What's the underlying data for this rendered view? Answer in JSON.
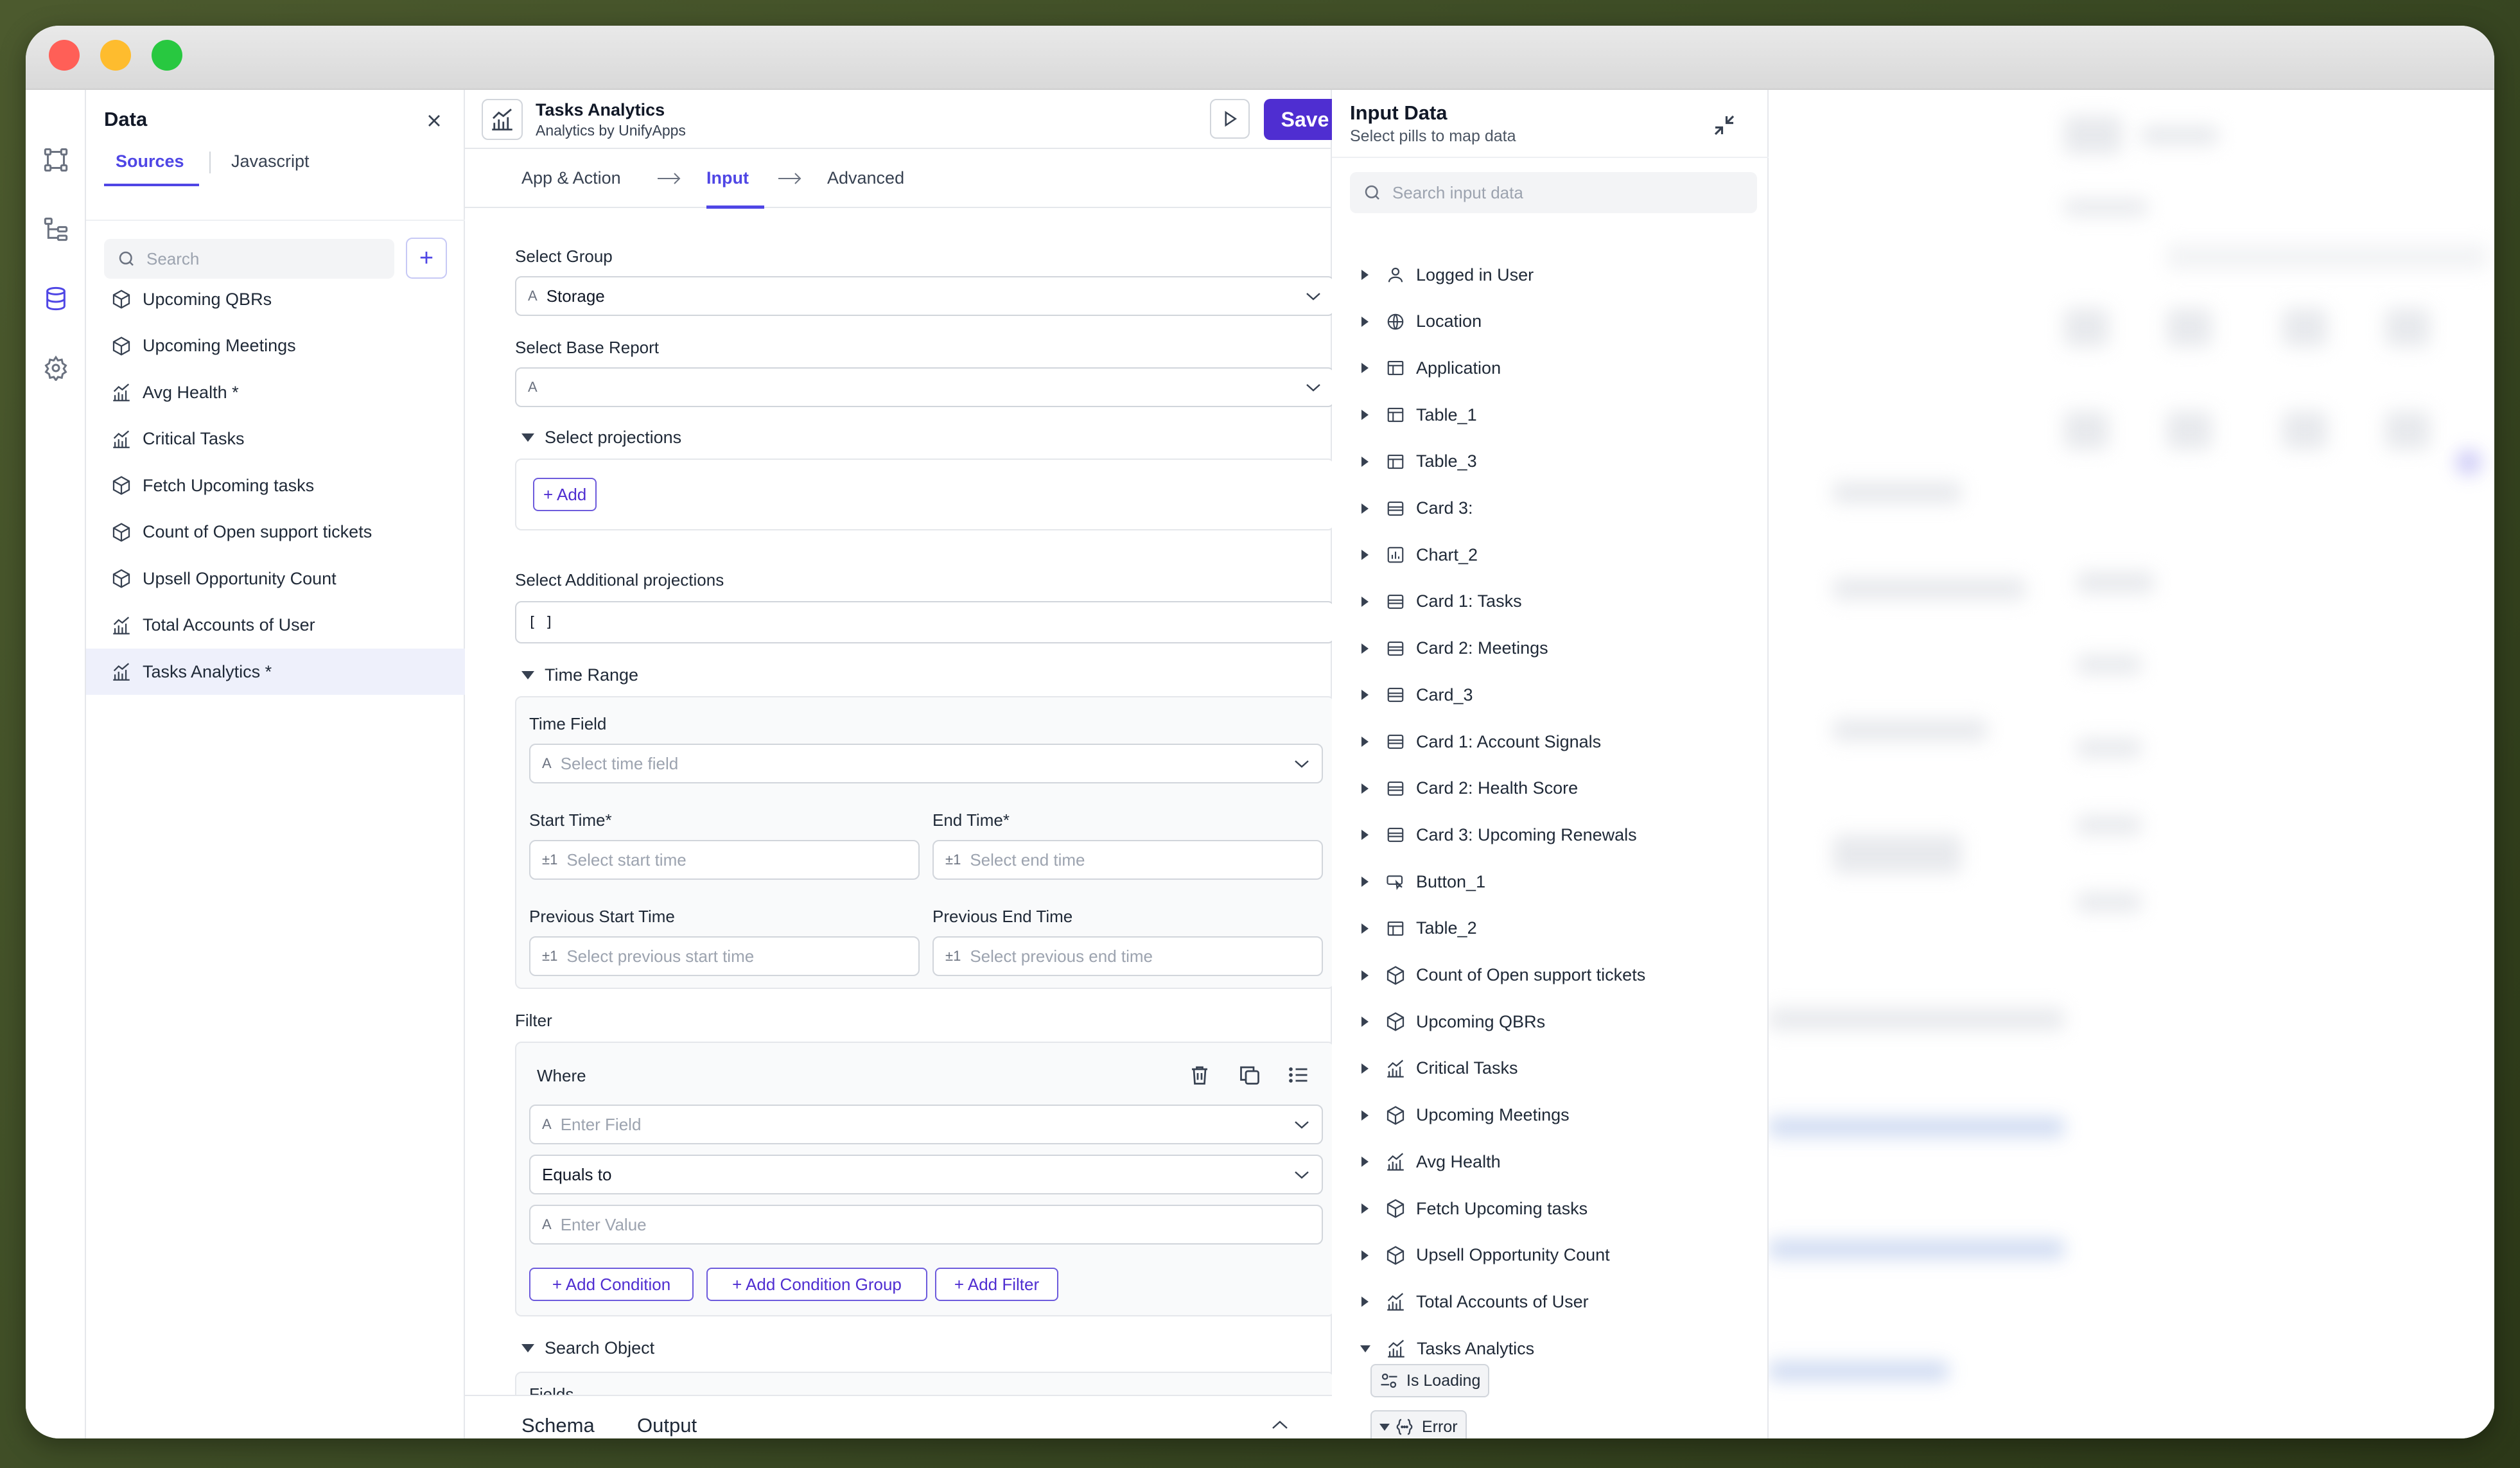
{
  "data_panel": {
    "title": "Data",
    "tabs": [
      "Sources",
      "Javascript"
    ],
    "search_placeholder": "Search",
    "add_label": "+",
    "items": [
      {
        "label": "Upcoming QBRs",
        "icon": "cube-icon"
      },
      {
        "label": "Upcoming Meetings",
        "icon": "cube-icon"
      },
      {
        "label": "Avg Health *",
        "icon": "analytics-icon"
      },
      {
        "label": "Critical Tasks",
        "icon": "analytics-icon"
      },
      {
        "label": "Fetch Upcoming tasks",
        "icon": "cube-icon"
      },
      {
        "label": "Count of Open support tickets",
        "icon": "cube-icon"
      },
      {
        "label": "Upsell Opportunity Count",
        "icon": "cube-icon"
      },
      {
        "label": "Total Accounts of User",
        "icon": "analytics-icon"
      },
      {
        "label": "Tasks Analytics *",
        "icon": "analytics-icon",
        "selected": true
      }
    ]
  },
  "header": {
    "title": "Tasks Analytics",
    "subtitle": "Analytics by UnifyApps",
    "save_label": "Save"
  },
  "steps": [
    "App & Action",
    "Input",
    "Advanced"
  ],
  "form": {
    "select_group_label": "Select Group",
    "select_group_value": "Storage",
    "base_report_label": "Select Base Report",
    "base_report_value": "",
    "projections_label": "Select projections",
    "add_label": "+ Add",
    "additional_projections_label": "Select Additional projections",
    "additional_projections_value": "[ ]",
    "time_range_label": "Time Range",
    "time_field_label": "Time Field",
    "time_field_placeholder": "Select time field",
    "start_time_label": "Start Time*",
    "start_time_placeholder": "Select start time",
    "end_time_label": "End Time*",
    "end_time_placeholder": "Select end time",
    "prev_start_label": "Previous Start Time",
    "prev_start_placeholder": "Select previous start time",
    "prev_end_label": "Previous End Time",
    "prev_end_placeholder": "Select previous end time",
    "pm_prefix": "±1",
    "filter_label": "Filter",
    "where_label": "Where",
    "enter_field_placeholder": "Enter Field",
    "operator_value": "Equals to",
    "enter_value_placeholder": "Enter Value",
    "add_condition": "+ Add Condition",
    "add_condition_group": "+ Add Condition Group",
    "add_filter": "+ Add Filter",
    "search_object_label": "Search Object",
    "fields_label": "Fields"
  },
  "bottom_tabs": [
    "Schema",
    "Output"
  ],
  "input_panel": {
    "title": "Input Data",
    "subtitle": "Select pills to map data",
    "search_placeholder": "Search input data",
    "items": [
      {
        "label": "Logged in User",
        "icon": "user-icon"
      },
      {
        "label": "Location",
        "icon": "globe-icon"
      },
      {
        "label": "Application",
        "icon": "table-icon"
      },
      {
        "label": "Table_1",
        "icon": "table-icon"
      },
      {
        "label": "Table_3",
        "icon": "table-icon"
      },
      {
        "label": "Card 3:",
        "icon": "card-icon"
      },
      {
        "label": "Chart_2",
        "icon": "chart-icon"
      },
      {
        "label": "Card 1: Tasks",
        "icon": "card-icon"
      },
      {
        "label": "Card 2: Meetings",
        "icon": "card-icon"
      },
      {
        "label": "Card_3",
        "icon": "card-icon"
      },
      {
        "label": "Card 1: Account Signals",
        "icon": "card-icon"
      },
      {
        "label": "Card 2: Health Score",
        "icon": "card-icon"
      },
      {
        "label": "Card 3: Upcoming Renewals",
        "icon": "card-icon"
      },
      {
        "label": "Button_1",
        "icon": "button-icon"
      },
      {
        "label": "Table_2",
        "icon": "table-icon"
      },
      {
        "label": "Count of Open support tickets",
        "icon": "cube-icon"
      },
      {
        "label": "Upcoming QBRs",
        "icon": "cube-icon"
      },
      {
        "label": "Critical Tasks",
        "icon": "analytics-icon"
      },
      {
        "label": "Upcoming Meetings",
        "icon": "cube-icon"
      },
      {
        "label": "Avg Health",
        "icon": "analytics-icon"
      },
      {
        "label": "Fetch Upcoming tasks",
        "icon": "cube-icon"
      },
      {
        "label": "Upsell Opportunity Count",
        "icon": "cube-icon"
      },
      {
        "label": "Total Accounts of User",
        "icon": "analytics-icon"
      },
      {
        "label": "Tasks Analytics",
        "icon": "analytics-icon",
        "expanded": true
      }
    ],
    "children": [
      {
        "label": "Is Loading",
        "icon": "toggle-icon"
      },
      {
        "label": "Error",
        "icon": "braces-icon"
      }
    ]
  },
  "colors": {
    "accent": "#4f46e5",
    "save_bg": "#4f2ed1",
    "traffic_red": "#ff5f57",
    "traffic_yellow": "#febc2e",
    "traffic_green": "#28c840"
  }
}
